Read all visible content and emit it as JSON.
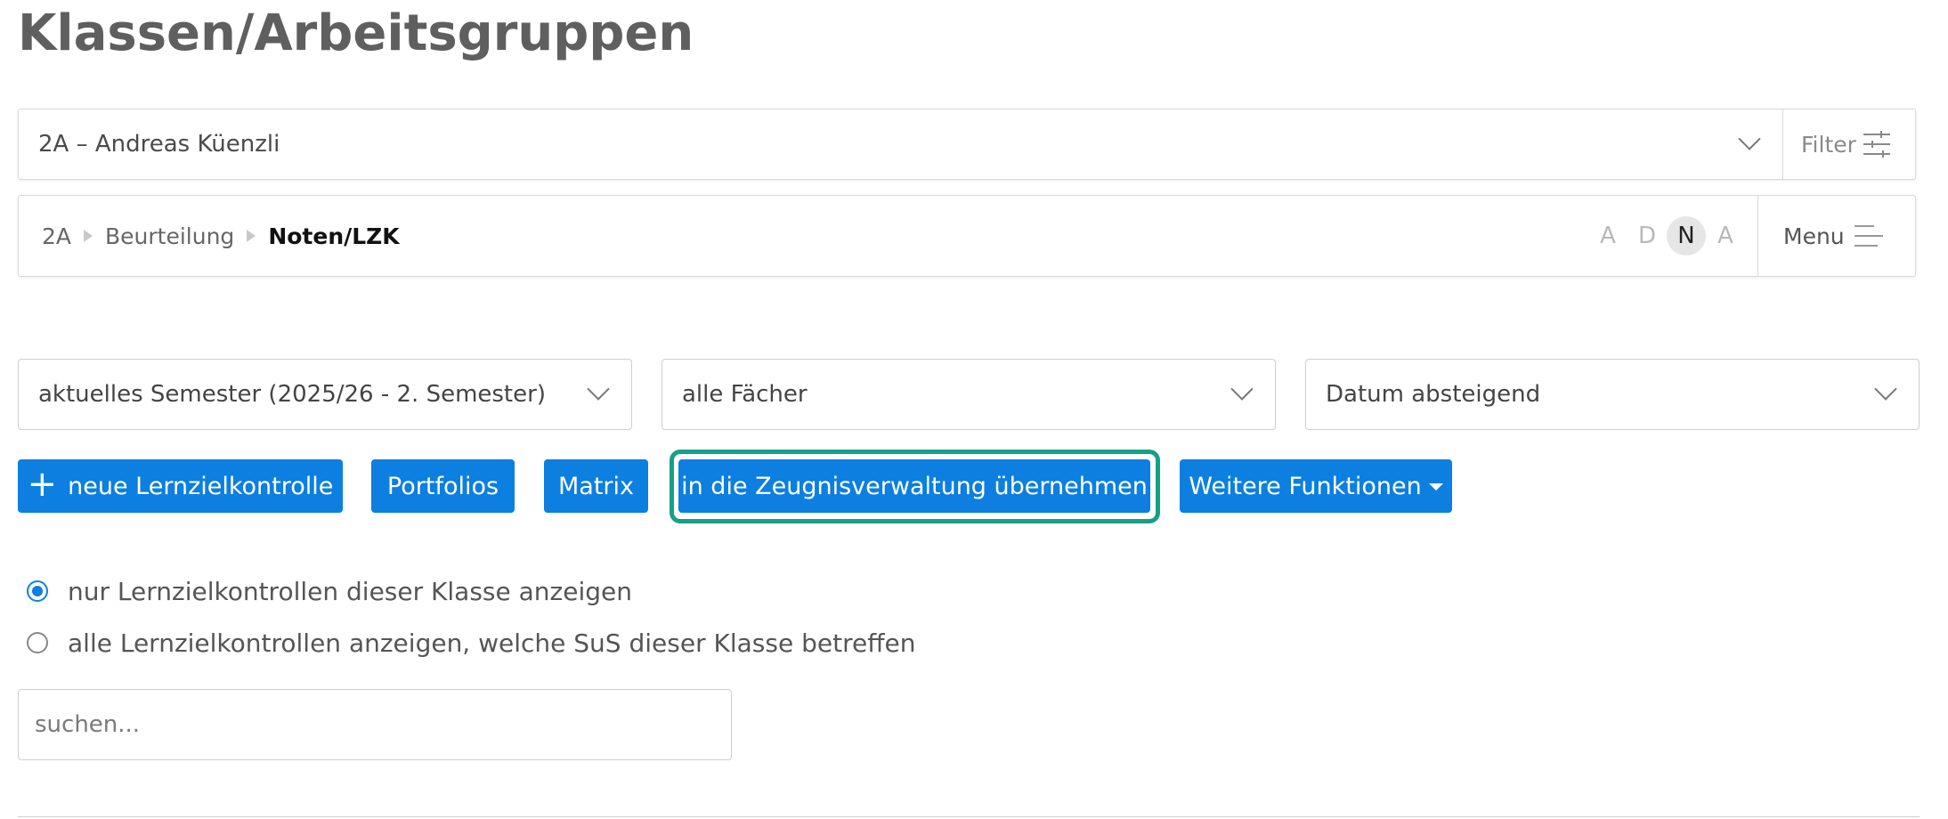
{
  "page": {
    "title": "Klassen/Arbeitsgruppen"
  },
  "class_selector": {
    "value": "2A – Andreas Küenzli",
    "filter_label": "Filter"
  },
  "breadcrumb": {
    "items": [
      "2A",
      "Beurteilung",
      "Noten/LZK"
    ]
  },
  "view_toggle": {
    "letters": [
      "A",
      "D",
      "N",
      "A"
    ],
    "active_index": 2
  },
  "menu": {
    "label": "Menu"
  },
  "dropdowns": {
    "semester": "aktuelles Semester (2025/26 - 2. Semester)",
    "subject": "alle Fächer",
    "sort": "Datum absteigend"
  },
  "buttons": {
    "new": "neue Lernzielkontrolle",
    "portfolios": "Portfolios",
    "matrix": "Matrix",
    "transfer": "in die Zeugnisverwaltung übernehmen",
    "more": "Weitere Funktionen"
  },
  "radio_options": [
    {
      "label": "nur Lernzielkontrollen dieser Klasse anzeigen",
      "checked": true
    },
    {
      "label": "alle Lernzielkontrollen anzeigen, welche SuS dieser Klasse betreffen",
      "checked": false
    }
  ],
  "search": {
    "placeholder": "suchen...",
    "value": ""
  },
  "colors": {
    "primary": "#0c7fe0",
    "highlight": "#16a085",
    "title": "#5f5f5f"
  },
  "icons": {
    "filter": "sliders-icon",
    "menu": "hamburger-icon",
    "dropdown": "chevron-down-icon",
    "plus": "plus-icon",
    "caret": "caret-down-icon"
  }
}
